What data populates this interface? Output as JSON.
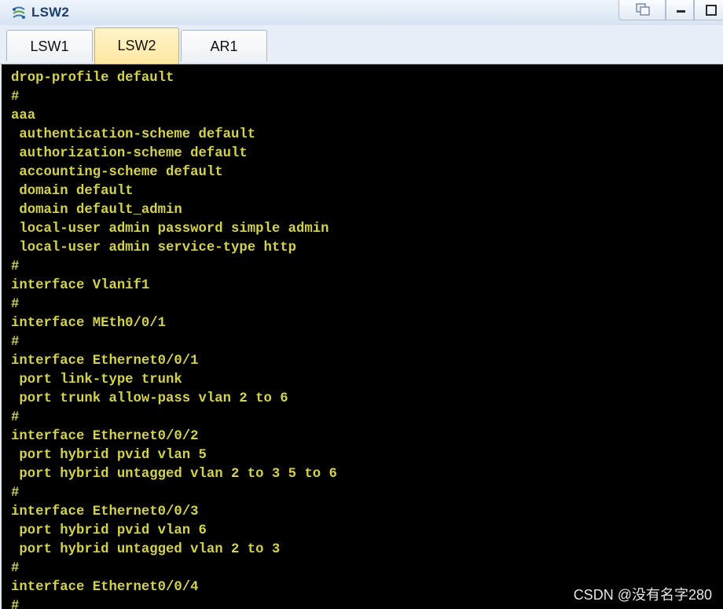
{
  "window": {
    "title": "LSW2",
    "icon": "device-icon"
  },
  "tabs": [
    {
      "label": "LSW1",
      "active": false
    },
    {
      "label": "LSW2",
      "active": true
    },
    {
      "label": "AR1",
      "active": false
    }
  ],
  "terminal": {
    "text_color": "#d4d24a",
    "background": "#000000",
    "lines": [
      "drop-profile default",
      "#",
      "aaa",
      " authentication-scheme default",
      " authorization-scheme default",
      " accounting-scheme default",
      " domain default",
      " domain default_admin",
      " local-user admin password simple admin",
      " local-user admin service-type http",
      "#",
      "interface Vlanif1",
      "#",
      "interface MEth0/0/1",
      "#",
      "interface Ethernet0/0/1",
      " port link-type trunk",
      " port trunk allow-pass vlan 2 to 6",
      "#",
      "interface Ethernet0/0/2",
      " port hybrid pvid vlan 5",
      " port hybrid untagged vlan 2 to 3 5 to 6",
      "#",
      "interface Ethernet0/0/3",
      " port hybrid pvid vlan 6",
      " port hybrid untagged vlan 2 to 3",
      "#",
      "interface Ethernet0/0/4",
      "#"
    ]
  },
  "watermark": "CSDN @没有名字280"
}
